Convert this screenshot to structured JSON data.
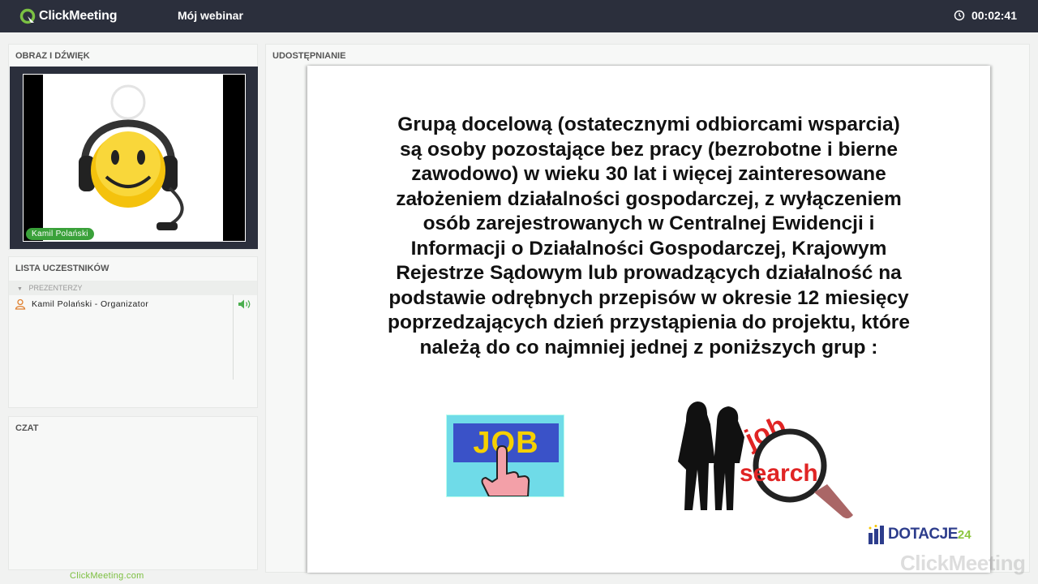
{
  "header": {
    "brand": "ClickMeeting",
    "title": "Mój webinar",
    "timer": "00:02:41"
  },
  "av_panel": {
    "title": "OBRAZ I DŹWIĘK",
    "presenter_name": "Kamil Polański"
  },
  "participants_panel": {
    "title": "LISTA UCZESTNIKÓW",
    "group_label": "PREZENTERZY",
    "participants": [
      {
        "name": "Kamil Polański - Organizator"
      }
    ]
  },
  "chat_panel": {
    "title": "CZAT"
  },
  "share_panel": {
    "title": "UDOSTĘPNIANIE",
    "slide_lines": [
      "Grupą docelową (ostatecznymi odbiorcami wsparcia)",
      "są osoby pozostające  bez  pracy (bezrobotne   i  bierne",
      "zawodowo) w  wieku  30  lat i więcej zainteresowane",
      "założeniem   działalności gospodarczej,   z   wyłączeniem",
      "osób zarejestrowanych w Centralnej Ewidencji  i",
      "Informacji o Działalności Gospodarczej, Krajowym",
      "Rejestrze Sądowym lub prowadzących  działalność na",
      "podstawie odrębnych przepisów w okresie 12 miesięcy",
      "poprzedzających dzień przystąpienia do projektu, które",
      "należą do co najmniej jednej z poniższych grup :"
    ],
    "job_sign": "JOB",
    "job_search_text": "job search",
    "sponsor_logo": "DOTACJE",
    "sponsor_number": "24",
    "watermark": "ClickMeeting"
  },
  "footer": {
    "link": "ClickMeeting.com"
  },
  "colors": {
    "topbar": "#2b2f3c",
    "accent_green": "#3aa13a",
    "link_green": "#7bbf3f"
  }
}
